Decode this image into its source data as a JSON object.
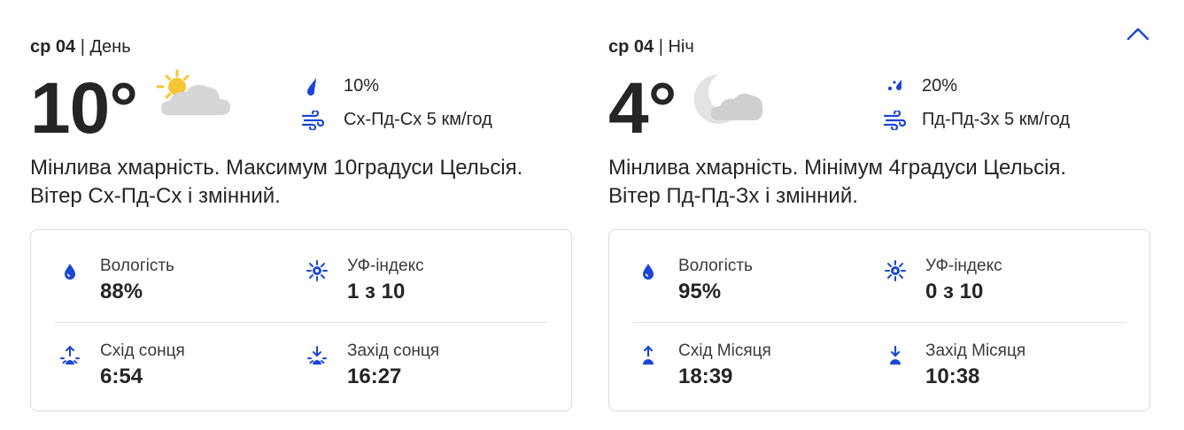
{
  "colors": {
    "accent": "#1a46d8",
    "text": "#252525",
    "border": "#dcdcdc"
  },
  "collapse_icon": "chevron-up-icon",
  "day": {
    "weekday": "ср 04",
    "separator": "|",
    "period": "День",
    "temperature": "10°",
    "weather_icon": "partly-cloudy-day-icon",
    "precipitation": "10%",
    "precip_icon": "raindrop-icon",
    "wind": "Сх-Пд-Сх 5 км/год",
    "wind_icon": "wind-icon",
    "description": "Мінлива хмарність. Максимум 10градуси Цельсія. Вітер Сх-Пд-Сх і змінний.",
    "details": {
      "humidity_label": "Вологість",
      "humidity_value": "88%",
      "uv_label": "УФ-індекс",
      "uv_value": "1 з 10",
      "rise_label": "Схід сонця",
      "rise_value": "6:54",
      "set_label": "Захід сонця",
      "set_value": "16:27"
    }
  },
  "night": {
    "weekday": "ср 04",
    "separator": "|",
    "period": "Ніч",
    "temperature": "4°",
    "weather_icon": "partly-cloudy-night-icon",
    "precipitation": "20%",
    "precip_icon": "rain-drops-icon",
    "wind": "Пд-Пд-Зх 5 км/год",
    "wind_icon": "wind-icon",
    "description": "Мінлива хмарність. Мінімум 4градуси Цельсія. Вітер Пд-Пд-Зх і змінний.",
    "details": {
      "humidity_label": "Вологість",
      "humidity_value": "95%",
      "uv_label": "УФ-індекс",
      "uv_value": "0 з 10",
      "rise_label": "Схід Місяця",
      "rise_value": "18:39",
      "set_label": "Захід Місяця",
      "set_value": "10:38"
    }
  }
}
